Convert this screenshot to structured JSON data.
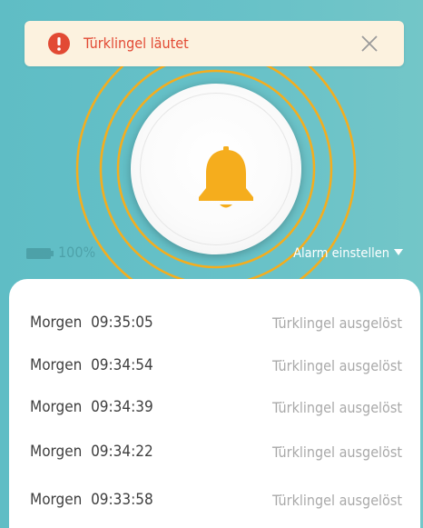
{
  "notification": {
    "icon": "exclamation-circle-icon",
    "message": "Türklingel läutet",
    "close_icon": "close-icon"
  },
  "doorbell": {
    "icon": "bell-icon",
    "ring_color": "#f5ad1d"
  },
  "battery": {
    "icon": "battery-icon",
    "level_text": "100%"
  },
  "alarm": {
    "label": "Alarm einstellen",
    "icon": "caret-down-icon"
  },
  "log": [
    {
      "time": "Morgen  09:35:05",
      "event": "Türklingel ausgelöst"
    },
    {
      "time": "Morgen  09:34:54",
      "event": "Türklingel ausgelöst"
    },
    {
      "time": "Morgen  09:34:39",
      "event": "Türklingel ausgelöst"
    },
    {
      "time": "Morgen  09:34:22",
      "event": "Türklingel ausgelöst"
    },
    {
      "time": "Morgen  09:33:58",
      "event": "Türklingel ausgelöst"
    }
  ],
  "colors": {
    "background": "#67c1c8",
    "accent": "#f5ad1d",
    "alert": "#e24a34",
    "notice_background": "#fcf2df"
  }
}
